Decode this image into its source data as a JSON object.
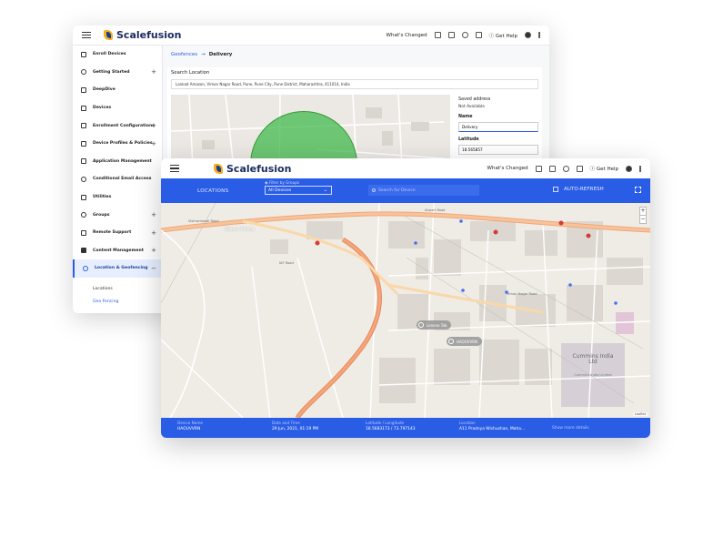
{
  "brand": {
    "name": "Scalefusion"
  },
  "topbar": {
    "whats_changed": "What's Changed",
    "get_help": "Get Help"
  },
  "sidebar": {
    "items": [
      {
        "label": "Enroll Devices",
        "icon": "enroll-icon",
        "expandable": false
      },
      {
        "label": "Getting Started",
        "icon": "rocket-icon",
        "expandable": true
      },
      {
        "label": "DeepDive",
        "icon": "chart-icon",
        "expandable": false
      },
      {
        "label": "Devices",
        "icon": "devices-icon",
        "expandable": false
      },
      {
        "label": "Enrollment Configurations",
        "icon": "phone-icon",
        "expandable": true
      },
      {
        "label": "Device Profiles & Policies",
        "icon": "clipboard-icon",
        "expandable": true
      },
      {
        "label": "Application Management",
        "icon": "apps-icon",
        "expandable": false
      },
      {
        "label": "Conditional Email Access",
        "icon": "at-icon",
        "expandable": false
      },
      {
        "label": "Utilities",
        "icon": "sliders-icon",
        "expandable": false
      },
      {
        "label": "Groups",
        "icon": "groups-icon",
        "expandable": true
      },
      {
        "label": "Remote Support",
        "icon": "cast-icon",
        "expandable": true
      },
      {
        "label": "Content Management",
        "icon": "image-icon",
        "expandable": true
      },
      {
        "label": "Location & Geofencing",
        "icon": "location-icon",
        "expandable": true,
        "active": true
      }
    ],
    "subitems": [
      {
        "label": "Locations"
      },
      {
        "label": "Geo Fencing",
        "active": true
      }
    ]
  },
  "geofence": {
    "breadcrumb_parent": "Geofences",
    "breadcrumb_current": "Delivery",
    "search_label": "Search Location",
    "search_value": "Lankad Amazon, Vimon Nagar Road, Pune, Pune City, Pune District, Maharashtra, 411014, India",
    "saved_address_label": "Saved address",
    "saved_address_value": "Not Available",
    "name_label": "Name",
    "name_value": "Delivery",
    "latitude_label": "Latitude",
    "latitude_value": "18.565857"
  },
  "locations": {
    "title": "LOCATIONS",
    "filter_label": "Filter by Groups",
    "filter_value": "All Devices",
    "search_placeholder": "Search for Device",
    "auto_refresh": "AUTO-REFRESH",
    "map_attribution": "Leaflet",
    "pins": [
      {
        "label": "Lenovo Tab"
      },
      {
        "label": "HAOUVVRN"
      }
    ],
    "map_labels": {
      "dhanori": "Dhanori Colony",
      "cummins": "Cummins India Ltd",
      "cummins_sub": "Cummins India Limited",
      "road_top": "Airport Road",
      "road_left": "Vishrantwadi Road",
      "road_vimannagar": "Viman Nagar Road",
      "road_iaf": "IAF Road"
    }
  },
  "device_info": {
    "headers": {
      "name": "Device Name",
      "datetime": "Date and Time",
      "latlng": "Latitude / Longitude",
      "location": "Location"
    },
    "values": {
      "name": "HAOUVVRN",
      "datetime": "29 Jun, 2021, 01:19 PM",
      "latlng": "18.5683173 / 73.797143",
      "location": "A11 Pradnya Wishushan, Maha..."
    },
    "more": "Show more details"
  },
  "colors": {
    "accent": "#2a5de6",
    "geofence": "#3cb946",
    "logo_yellow": "#f2b01e",
    "logo_navy": "#1b3b8f"
  }
}
